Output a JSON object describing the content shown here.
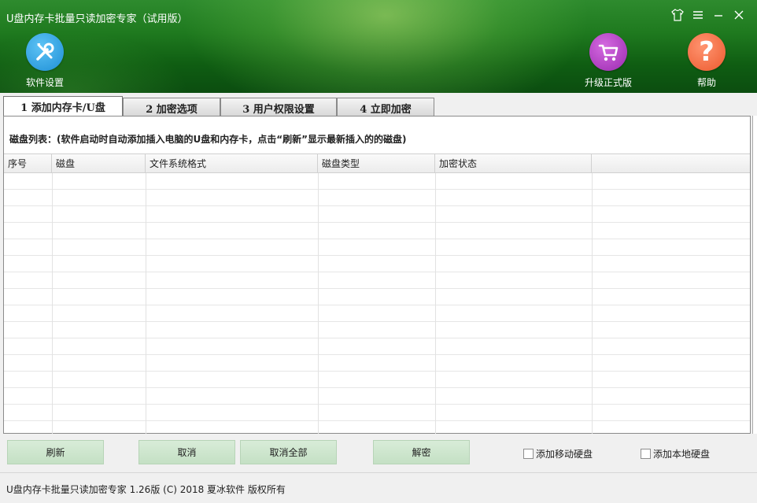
{
  "window": {
    "title": "U盘内存卡批量只读加密专家（试用版）",
    "controls": {
      "skin": "shirt-icon",
      "menu": "menu-icon",
      "minimize": "minimize-icon",
      "close": "close-icon"
    }
  },
  "header": {
    "settings_label": "软件设置",
    "upgrade_label": "升级正式版",
    "help_label": "帮助",
    "help_symbol": "?"
  },
  "tabs": [
    {
      "label": "1 添加内存卡/U盘",
      "active": true
    },
    {
      "label": "2 加密选项",
      "active": false
    },
    {
      "label": "3 用户权限设置",
      "active": false
    },
    {
      "label": "4 立即加密",
      "active": false
    }
  ],
  "panel": {
    "caption": "磁盘列表：(软件启动时自动添加插入电脑的U盘和内存卡，点击“刷新”显示最新插入的的磁盘)"
  },
  "table": {
    "columns": [
      "序号",
      "磁盘",
      "文件系统格式",
      "磁盘类型",
      "加密状态",
      ""
    ],
    "rows": []
  },
  "actions": {
    "refresh": "刷新",
    "cancel": "取消",
    "cancel_all": "取消全部",
    "decrypt": "解密"
  },
  "checkboxes": {
    "add_mobile_hdd": {
      "label": "添加移动硬盘",
      "checked": false
    },
    "add_local_hdd": {
      "label": "添加本地硬盘",
      "checked": false
    }
  },
  "status_bar": {
    "text": "U盘内存卡批量只读加密专家 1.26版 (C) 2018 夏冰软件 版权所有"
  },
  "colors": {
    "header_green": "#1f7a1f",
    "button_green": "#cfe6cf",
    "settings_blue": "#1e8fd6",
    "upgrade_purple": "#9b2bb0",
    "help_orange": "#ec5a2e"
  }
}
